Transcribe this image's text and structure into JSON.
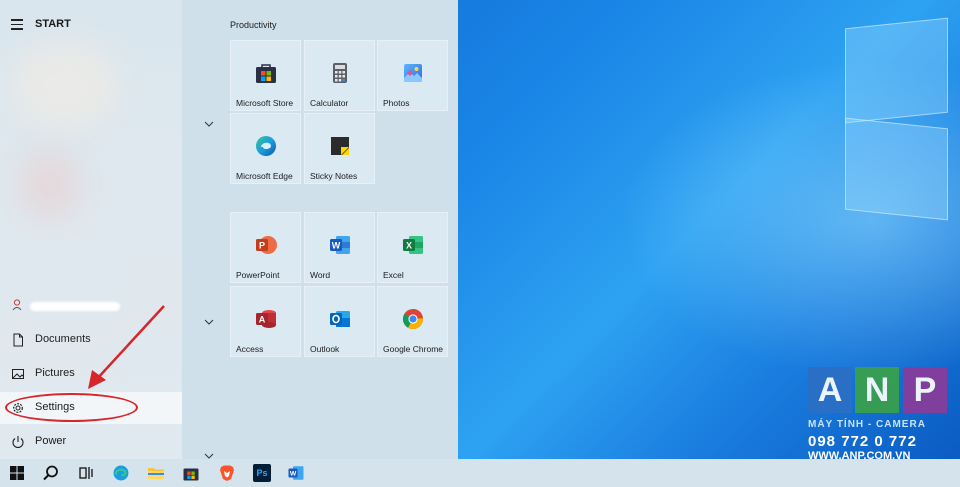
{
  "start_menu": {
    "title": "START",
    "rail_items": [
      {
        "label": "Documents",
        "icon": "document-icon"
      },
      {
        "label": "Pictures",
        "icon": "pictures-icon"
      },
      {
        "label": "Settings",
        "icon": "gear-icon"
      },
      {
        "label": "Power",
        "icon": "power-icon"
      }
    ],
    "groups": [
      {
        "label": "Productivity",
        "tiles": [
          {
            "label": "Microsoft Store",
            "icon": "store-icon"
          },
          {
            "label": "Calculator",
            "icon": "calculator-icon"
          },
          {
            "label": "Photos",
            "icon": "photos-icon"
          },
          {
            "label": "Microsoft Edge",
            "icon": "edge-icon"
          },
          {
            "label": "Sticky Notes",
            "icon": "sticky-notes-icon"
          }
        ]
      },
      {
        "label": "",
        "tiles": [
          {
            "label": "PowerPoint",
            "icon": "powerpoint-icon"
          },
          {
            "label": "Word",
            "icon": "word-icon"
          },
          {
            "label": "Excel",
            "icon": "excel-icon"
          },
          {
            "label": "Access",
            "icon": "access-icon"
          },
          {
            "label": "Outlook",
            "icon": "outlook-icon"
          },
          {
            "label": "Google Chrome",
            "icon": "chrome-icon"
          }
        ]
      }
    ]
  },
  "taskbar": {
    "items": [
      "start-icon",
      "search-icon",
      "task-view-icon",
      "edge-icon",
      "file-explorer-icon",
      "store-icon",
      "brave-icon",
      "photoshop-icon",
      "word-icon"
    ],
    "photoshop_text": "Ps"
  },
  "watermark": {
    "letters": [
      "A",
      "N",
      "P"
    ],
    "tagline": "MÁY TÍNH - CAMERA",
    "phone": "098 772 0 772",
    "website": "WWW.ANP.COM.VN"
  },
  "colors": {
    "accent_red": "#d6262a",
    "anp_blue": "#2b6fc4",
    "anp_green": "#3aa14a",
    "anp_purple": "#8a3b9a"
  }
}
